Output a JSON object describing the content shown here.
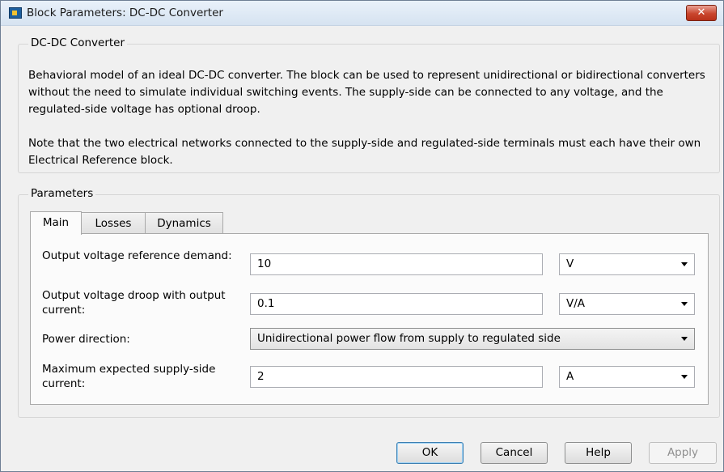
{
  "window": {
    "title": "Block Parameters: DC-DC Converter",
    "close_glyph": "✕"
  },
  "block": {
    "name": "DC-DC Converter",
    "description": "Behavioral model of an ideal DC-DC converter. The block can be used to represent unidirectional or bidirectional converters without the need to simulate individual switching events. The supply-side can be connected to any voltage, and the regulated-side voltage has optional droop.",
    "note": "Note that the two electrical networks connected to the supply-side and regulated-side terminals must each have their own Electrical Reference block."
  },
  "parameters": {
    "group_label": "Parameters",
    "tabs": [
      {
        "label": "Main",
        "active": true
      },
      {
        "label": "Losses",
        "active": false
      },
      {
        "label": "Dynamics",
        "active": false
      }
    ],
    "rows": [
      {
        "label": "Output voltage reference demand:",
        "value": "10",
        "unit": "V"
      },
      {
        "label": "Output voltage droop with output current:",
        "value": "0.1",
        "unit": "V/A"
      },
      {
        "label": "Power direction:",
        "value": "Unidirectional power flow from supply to regulated side"
      },
      {
        "label": "Maximum expected supply-side current:",
        "value": "2",
        "unit": "A"
      }
    ]
  },
  "buttons": {
    "ok": "OK",
    "cancel": "Cancel",
    "help": "Help",
    "apply": "Apply"
  }
}
